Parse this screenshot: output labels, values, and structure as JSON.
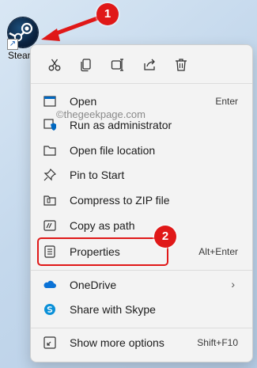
{
  "desktop": {
    "icon_label": "Steam",
    "icon_name": "steam-icon"
  },
  "annotations": {
    "step1": "1",
    "step2": "2",
    "color": "#e01818"
  },
  "watermark": "©thegeekpage.com",
  "quick_actions": [
    {
      "name": "cut-icon"
    },
    {
      "name": "copy-icon"
    },
    {
      "name": "rename-icon"
    },
    {
      "name": "share-icon"
    },
    {
      "name": "delete-icon"
    }
  ],
  "menu": {
    "open": {
      "label": "Open",
      "shortcut": "Enter"
    },
    "run_as_admin": {
      "label": "Run as administrator"
    },
    "open_location": {
      "label": "Open file location"
    },
    "pin_start": {
      "label": "Pin to Start"
    },
    "compress": {
      "label": "Compress to ZIP file"
    },
    "copy_path": {
      "label": "Copy as path"
    },
    "properties": {
      "label": "Properties",
      "shortcut": "Alt+Enter"
    },
    "onedrive": {
      "label": "OneDrive",
      "chevron": "›"
    },
    "skype": {
      "label": "Share with Skype"
    },
    "more_options": {
      "label": "Show more options",
      "shortcut": "Shift+F10"
    }
  },
  "colors": {
    "accent": "#0067c0",
    "onedrive": "#0a72d6",
    "skype": "#0a90d8"
  }
}
